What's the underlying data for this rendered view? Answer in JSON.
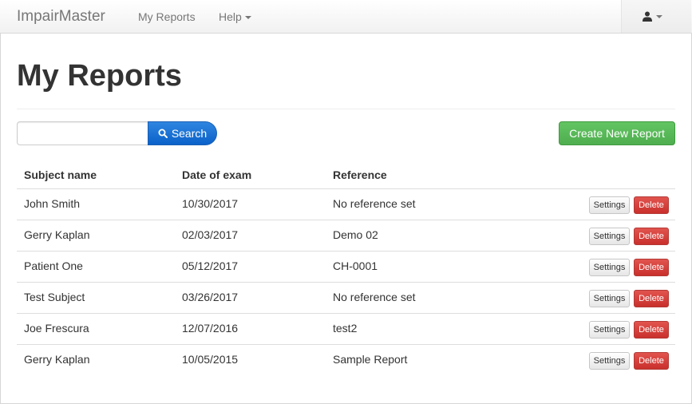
{
  "navbar": {
    "brand": "ImpairMaster",
    "links": [
      {
        "label": "My Reports"
      },
      {
        "label": "Help"
      }
    ]
  },
  "page": {
    "title": "My Reports"
  },
  "search": {
    "value": "",
    "placeholder": "",
    "button_label": "Search"
  },
  "actions": {
    "create_label": "Create New Report"
  },
  "table": {
    "headers": [
      "Subject name",
      "Date of exam",
      "Reference"
    ],
    "rows": [
      {
        "name": "John Smith",
        "date": "10/30/2017",
        "reference": "No reference set"
      },
      {
        "name": "Gerry Kaplan",
        "date": "02/03/2017",
        "reference": "Demo 02"
      },
      {
        "name": "Patient One",
        "date": "05/12/2017",
        "reference": "CH-0001"
      },
      {
        "name": "Test Subject",
        "date": "03/26/2017",
        "reference": "No reference set"
      },
      {
        "name": "Joe Frescura",
        "date": "12/07/2016",
        "reference": "test2"
      },
      {
        "name": "Gerry Kaplan",
        "date": "10/05/2015",
        "reference": "Sample Report"
      }
    ],
    "row_actions": {
      "settings_label": "Settings",
      "delete_label": "Delete"
    }
  },
  "icons": {
    "user": "user-icon",
    "search": "search-icon"
  },
  "colors": {
    "primary": "#0a61c9",
    "success": "#5cb85c",
    "danger": "#d9534f"
  }
}
